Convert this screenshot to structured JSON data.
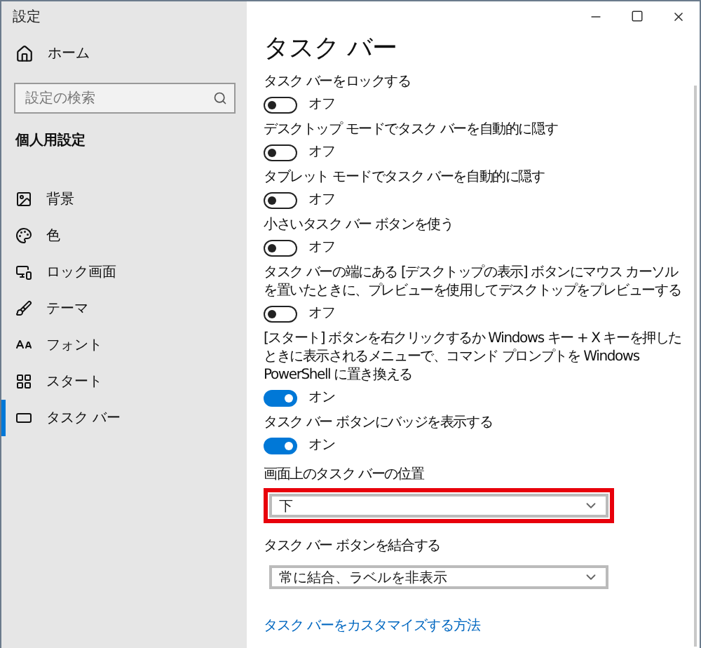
{
  "window": {
    "title": "設定"
  },
  "sidebar": {
    "home": "ホーム",
    "search": {
      "placeholder": "設定の検索"
    },
    "section": "個人用設定",
    "items": [
      {
        "kind": "background",
        "label": "背景",
        "selected": false
      },
      {
        "kind": "color",
        "label": "色",
        "selected": false
      },
      {
        "kind": "lock",
        "label": "ロック画面",
        "selected": false
      },
      {
        "kind": "theme",
        "label": "テーマ",
        "selected": false
      },
      {
        "kind": "font",
        "label": "フォント",
        "selected": false
      },
      {
        "kind": "start",
        "label": "スタート",
        "selected": false
      },
      {
        "kind": "taskbar",
        "label": "タスク バー",
        "selected": true
      }
    ]
  },
  "page": {
    "title": "タスク バー",
    "toggles": [
      {
        "label": "タスク バーをロックする",
        "on": false,
        "state": "オフ"
      },
      {
        "label": "デスクトップ モードでタスク バーを自動的に隠す",
        "on": false,
        "state": "オフ"
      },
      {
        "label": "タブレット モードでタスク バーを自動的に隠す",
        "on": false,
        "state": "オフ"
      },
      {
        "label": "小さいタスク バー ボタンを使う",
        "on": false,
        "state": "オフ"
      },
      {
        "label": "タスク バーの端にある [デスクトップの表示] ボタンにマウス カーソルを置いたときに、プレビューを使用してデスクトップをプレビューする",
        "on": false,
        "state": "オフ"
      },
      {
        "label": "[スタート] ボタンを右クリックするか Windows キー + X キーを押したときに表示されるメニューで、コマンド プロンプトを Windows PowerShell に置き換える",
        "on": true,
        "state": "オン"
      },
      {
        "label": "タスク バー ボタンにバッジを表示する",
        "on": true,
        "state": "オン"
      }
    ],
    "dropdowns": [
      {
        "label": "画面上のタスク バーの位置",
        "value": "下",
        "highlighted": true
      },
      {
        "label": "タスク バー ボタンを結合する",
        "value": "常に結合、ラベルを非表示",
        "highlighted": false
      }
    ],
    "link": "タスク バーをカスタマイズする方法"
  }
}
